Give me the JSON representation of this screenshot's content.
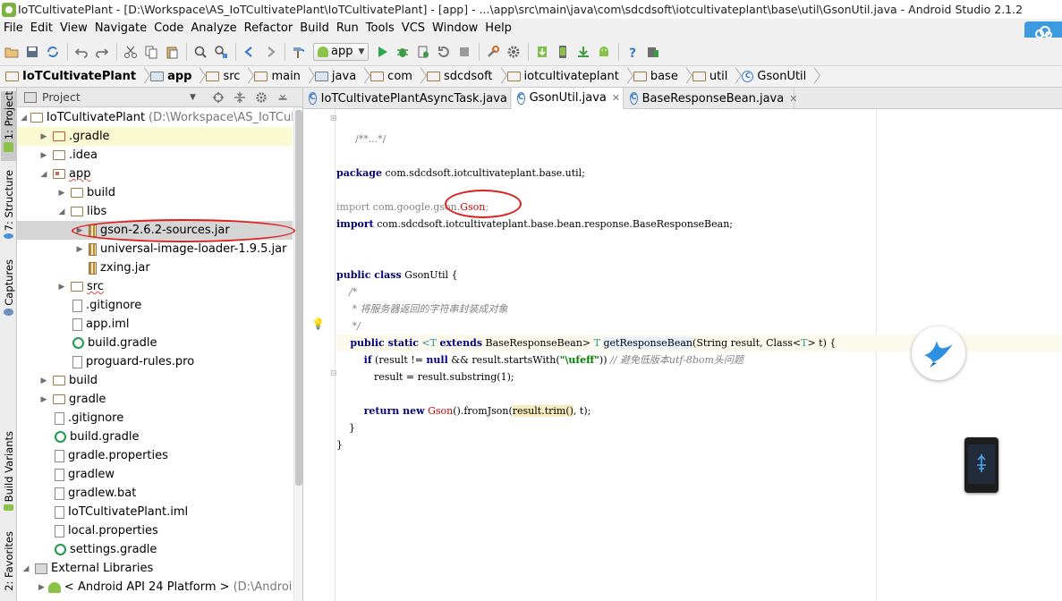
{
  "window": {
    "title": "IoTCultivatePlant - [D:\\Workspace\\AS_IoTCultivatePlant\\IoTCultivatePlant] - [app] - ...\\app\\src\\main\\java\\com\\sdcdsoft\\iotcultivateplant\\base\\util\\GsonUtil.java - Android Studio 2.1.2"
  },
  "menu": [
    "File",
    "Edit",
    "View",
    "Navigate",
    "Code",
    "Analyze",
    "Refactor",
    "Build",
    "Run",
    "Tools",
    "VCS",
    "Window",
    "Help"
  ],
  "toolbar": {
    "run_config": "app"
  },
  "breadcrumb": [
    "IoTCultivatePlant",
    "app",
    "src",
    "main",
    "java",
    "com",
    "sdcdsoft",
    "iotcultivateplant",
    "base",
    "util",
    "GsonUtil"
  ],
  "left_tabs": [
    "1: Project",
    "7: Structure",
    "Captures",
    "Build Variants",
    "2: Favorites"
  ],
  "project_panel": {
    "header": "Project",
    "tree": [
      {
        "label": "IoTCultivatePlant",
        "suffix": "(D:\\Workspace\\AS_IoTCultiva"
      },
      {
        "label": ".gradle"
      },
      {
        "label": ".idea"
      },
      {
        "label": "app"
      },
      {
        "label": "build"
      },
      {
        "label": "libs"
      },
      {
        "label": "gson-2.6.2-sources.jar"
      },
      {
        "label": "universal-image-loader-1.9.5.jar"
      },
      {
        "label": "zxing.jar"
      },
      {
        "label": "src"
      },
      {
        "label": ".gitignore"
      },
      {
        "label": "app.iml"
      },
      {
        "label": "build.gradle"
      },
      {
        "label": "proguard-rules.pro"
      },
      {
        "label": "build"
      },
      {
        "label": "gradle"
      },
      {
        "label": ".gitignore"
      },
      {
        "label": "build.gradle"
      },
      {
        "label": "gradle.properties"
      },
      {
        "label": "gradlew"
      },
      {
        "label": "gradlew.bat"
      },
      {
        "label": "IoTCultivatePlant.iml"
      },
      {
        "label": "local.properties"
      },
      {
        "label": "settings.gradle"
      },
      {
        "label": "External Libraries"
      },
      {
        "label": "< Android API 24 Platform >",
        "suffix": "(D:\\Android_"
      }
    ]
  },
  "editor": {
    "tabs": [
      "IoTCultivatePlantAsyncTask.java",
      "GsonUtil.java",
      "BaseResponseBean.java"
    ],
    "active_tab": "GsonUtil.java",
    "code": {
      "l1": "/**...*/",
      "package_kw": "package",
      "package_name": " com.sdcdsoft.iotcultivateplant.base.util;",
      "import_kw": "import",
      "import1_a": " com.google.gson.",
      "import1_b": "Gson",
      "import1_c": ";",
      "import2": " com.sdcdsoft.iotcultivateplant.base.bean.response.BaseResponseBean;",
      "class_kw": "public class",
      "class_name": " GsonUtil {",
      "c_open": "    /*",
      "c_body": "     * 将服务器返回的字符串封装成对象",
      "c_close": "     */",
      "m_kw": "    public static",
      "m_generic_open": " <T ",
      "m_extends": "extends",
      "m_bound": " BaseResponseBean> ",
      "m_T": "T",
      "m_name": "getResponseBean",
      "m_params_a": "(String result, Class<",
      "m_params_T": "T",
      "m_params_b": "> t) {",
      "if_kw": "        if",
      "if_a": " (result != ",
      "null_kw": "null",
      "if_b": " && result.startsWith(",
      "if_str": "\"\\ufeff\"",
      "if_c": ")) ",
      "if_cmt": "// 避免低版本utf-8bom头问题",
      "assign": "            result = result.substring(1);",
      "return_kw": "        return new",
      "ret_gson": " Gson",
      "ret_a": "().fromJson(",
      "ret_trim": "result.trim()",
      "ret_b": ", t);",
      "close_inner": "    }",
      "close_outer": "}"
    }
  }
}
